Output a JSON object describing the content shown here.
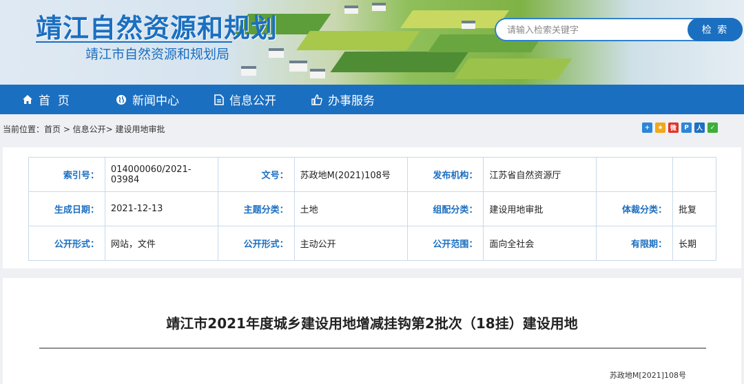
{
  "header": {
    "title": "靖江自然资源和规划",
    "subtitle": "靖江市自然资源和规划局",
    "search_placeholder": "请输入检索关键字",
    "search_button": "检 索"
  },
  "nav": {
    "items": [
      {
        "label": "首  页",
        "icon": "home-icon"
      },
      {
        "label": "新闻中心",
        "icon": "globe-icon"
      },
      {
        "label": "信息公开",
        "icon": "document-icon"
      },
      {
        "label": "办事服务",
        "icon": "thumbs-up-icon"
      }
    ]
  },
  "breadcrumb": "当前位置：首页 > 信息公开> 建设用地审批",
  "share_icons": [
    {
      "name": "add-share-icon",
      "glyph": "+",
      "color": "#2d86d6"
    },
    {
      "name": "qzone-share-icon",
      "glyph": "★",
      "color": "#f1a81b"
    },
    {
      "name": "weibo-share-icon",
      "glyph": "微",
      "color": "#e0352b"
    },
    {
      "name": "tencent-share-icon",
      "glyph": "P",
      "color": "#2d86d6"
    },
    {
      "name": "renren-share-icon",
      "glyph": "人",
      "color": "#1e6fc2"
    },
    {
      "name": "wechat-share-icon",
      "glyph": "✓",
      "color": "#3fae3a"
    }
  ],
  "meta": {
    "index_label": "索引号：",
    "index_value": "014000060/2021-03984",
    "docno_label": "文号：",
    "docno_value": "苏政地M(2021)108号",
    "publisher_label": "发布机构：",
    "publisher_value": "江苏省自然资源厅",
    "date_label": "生成日期：",
    "date_value": "2021-12-13",
    "topic_label": "主题分类：",
    "topic_value": "土地",
    "group_label": "组配分类：",
    "group_value": "建设用地审批",
    "genre_label": "体裁分类：",
    "genre_value": "批复",
    "form_label": "公开形式：",
    "form_value": "网站，文件",
    "mode_label": "公开形式：",
    "mode_value": "主动公开",
    "scope_label": "公开范围：",
    "scope_value": "面向全社会",
    "validity_label": "有限期：",
    "validity_value": "长期"
  },
  "article": {
    "title": "靖江市2021年度城乡建设用地增减挂钩第2批次（18挂）建设用地",
    "doc_number": "苏政地M[2021]108号"
  }
}
